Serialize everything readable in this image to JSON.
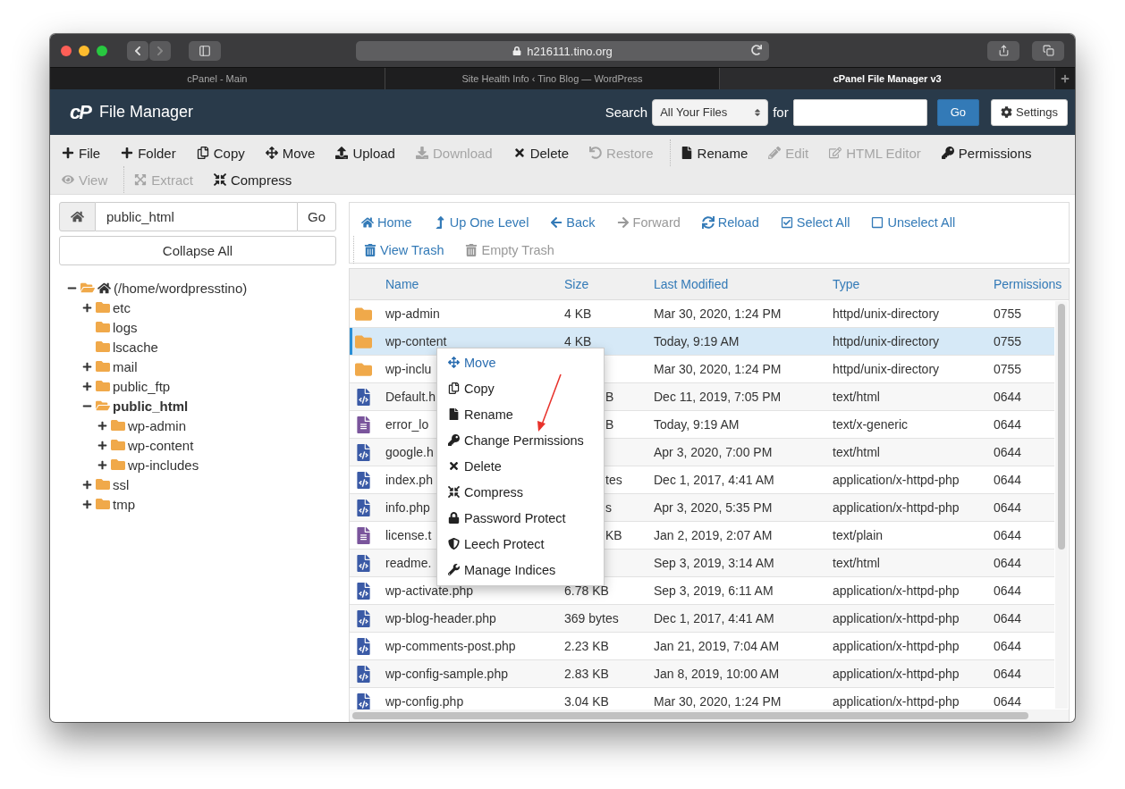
{
  "browser": {
    "url": "h216111.tino.org",
    "tabs": [
      {
        "label": "cPanel - Main",
        "selected": false
      },
      {
        "label": "Site Health Info ‹ Tino Blog — WordPress",
        "selected": false
      },
      {
        "label": "cPanel File Manager v3",
        "selected": true
      }
    ]
  },
  "header": {
    "logo": "cP",
    "title": "File Manager",
    "search_label": "Search",
    "scope": "All Your Files",
    "for_label": "for",
    "go": "Go",
    "settings": "Settings"
  },
  "toolbar": [
    [
      {
        "buttons": [
          {
            "label": "File",
            "disabled": false
          },
          {
            "label": "Folder",
            "disabled": false
          },
          {
            "label": "Copy",
            "disabled": false
          },
          {
            "label": "Move",
            "disabled": false
          },
          {
            "label": "Upload",
            "disabled": false
          },
          {
            "label": "Download",
            "disabled": true
          },
          {
            "label": "Delete",
            "disabled": false
          },
          {
            "label": "Restore",
            "disabled": true
          }
        ]
      },
      {
        "buttons": [
          {
            "label": "Rename",
            "disabled": false
          },
          {
            "label": "Edit",
            "disabled": true
          },
          {
            "label": "HTML Editor",
            "disabled": true
          },
          {
            "label": "Permissions",
            "disabled": false
          }
        ]
      }
    ],
    [
      {
        "buttons": [
          {
            "label": "View",
            "disabled": true
          }
        ]
      },
      {
        "buttons": [
          {
            "label": "Extract",
            "disabled": true
          },
          {
            "label": "Compress",
            "disabled": false
          }
        ]
      }
    ]
  ],
  "path_bar": {
    "value": "public_html",
    "go": "Go"
  },
  "collapse_all": "Collapse All",
  "tree": [
    {
      "label": "(/home/wordpresstino)",
      "root": true,
      "expanded": true,
      "selected": false,
      "children": [
        {
          "label": "etc",
          "expanded": false,
          "selected": false
        },
        {
          "label": "logs",
          "selected": false
        },
        {
          "label": "lscache",
          "selected": false
        },
        {
          "label": "mail",
          "expanded": false,
          "selected": false
        },
        {
          "label": "public_ftp",
          "expanded": false,
          "selected": false
        },
        {
          "label": "public_html",
          "expanded": true,
          "selected": true,
          "children": [
            {
              "label": "wp-admin",
              "expanded": false,
              "selected": false
            },
            {
              "label": "wp-content",
              "expanded": false,
              "selected": false
            },
            {
              "label": "wp-includes",
              "expanded": false,
              "selected": false
            }
          ]
        },
        {
          "label": "ssl",
          "expanded": false,
          "selected": false
        },
        {
          "label": "tmp",
          "expanded": false,
          "selected": false
        }
      ]
    }
  ],
  "nav": [
    {
      "buttons": [
        {
          "label": "Home",
          "disabled": false
        },
        {
          "label": "Up One Level",
          "disabled": false
        },
        {
          "label": "Back",
          "disabled": false
        },
        {
          "label": "Forward",
          "disabled": true
        },
        {
          "label": "Reload",
          "disabled": false
        },
        {
          "label": "Select All",
          "disabled": false
        },
        {
          "label": "Unselect All",
          "disabled": false
        }
      ]
    },
    {
      "buttons": [
        {
          "label": "View Trash",
          "disabled": false
        },
        {
          "label": "Empty Trash",
          "disabled": true
        }
      ]
    }
  ],
  "table": {
    "columns": [
      "Name",
      "Size",
      "Last Modified",
      "Type",
      "Permissions"
    ],
    "rows": [
      {
        "kind": "folder",
        "name": "wp-admin",
        "size": "4 KB",
        "modified": "Mar 30, 2020, 1:24 PM",
        "type": "httpd/unix-directory",
        "perms": "0755",
        "selected": false
      },
      {
        "kind": "folder",
        "name": "wp-content",
        "size": "4 KB",
        "modified": "Today, 9:19 AM",
        "type": "httpd/unix-directory",
        "perms": "0755",
        "selected": true
      },
      {
        "kind": "folder",
        "name": "wp-inclu",
        "modified": "Mar 30, 2020, 1:24 PM",
        "type": "httpd/unix-directory",
        "perms": "0755",
        "selected": false
      },
      {
        "kind": "code",
        "name": "Default.h",
        "size": "B",
        "modified": "Dec 11, 2019, 7:05 PM",
        "type": "text/html",
        "perms": "0644",
        "selected": false,
        "covered": true
      },
      {
        "kind": "text",
        "name": "error_lo",
        "size": "B",
        "modified": "Today, 9:19 AM",
        "type": "text/x-generic",
        "perms": "0644",
        "selected": false,
        "covered": true
      },
      {
        "kind": "code",
        "name": "google.h",
        "modified": "Apr 3, 2020, 7:00 PM",
        "type": "text/html",
        "perms": "0644",
        "selected": false
      },
      {
        "kind": "code",
        "name": "index.ph",
        "size": "tes",
        "modified": "Dec 1, 2017, 4:41 AM",
        "type": "application/x-httpd-php",
        "perms": "0644",
        "selected": false,
        "covered": true
      },
      {
        "kind": "code",
        "name": "info.php",
        "size": "s",
        "modified": "Apr 3, 2020, 5:35 PM",
        "type": "application/x-httpd-php",
        "perms": "0644",
        "selected": false,
        "covered": true
      },
      {
        "kind": "text",
        "name": "license.t",
        "size": "KB",
        "modified": "Jan 2, 2019, 2:07 AM",
        "type": "text/plain",
        "perms": "0644",
        "selected": false,
        "covered": true
      },
      {
        "kind": "code",
        "name": "readme.",
        "modified": "Sep 3, 2019, 3:14 AM",
        "type": "text/html",
        "perms": "0644",
        "selected": false
      },
      {
        "kind": "code",
        "name": "wp-activate.php",
        "size": "6.78 KB",
        "modified": "Sep 3, 2019, 6:11 AM",
        "type": "application/x-httpd-php",
        "perms": "0644",
        "selected": false
      },
      {
        "kind": "code",
        "name": "wp-blog-header.php",
        "size": "369 bytes",
        "modified": "Dec 1, 2017, 4:41 AM",
        "type": "application/x-httpd-php",
        "perms": "0644",
        "selected": false
      },
      {
        "kind": "code",
        "name": "wp-comments-post.php",
        "size": "2.23 KB",
        "modified": "Jan 21, 2019, 7:04 AM",
        "type": "application/x-httpd-php",
        "perms": "0644",
        "selected": false
      },
      {
        "kind": "code",
        "name": "wp-config-sample.php",
        "size": "2.83 KB",
        "modified": "Jan 8, 2019, 10:00 AM",
        "type": "application/x-httpd-php",
        "perms": "0644",
        "selected": false
      },
      {
        "kind": "code",
        "name": "wp-config.php",
        "size": "3.04 KB",
        "modified": "Mar 30, 2020, 1:24 PM",
        "type": "application/x-httpd-php",
        "perms": "0644",
        "selected": false
      }
    ]
  },
  "context_menu": [
    {
      "label": "Move",
      "selected": true
    },
    {
      "label": "Copy",
      "selected": false
    },
    {
      "label": "Rename",
      "selected": false
    },
    {
      "label": "Change Permissions",
      "selected": false
    },
    {
      "label": "Delete",
      "selected": false
    },
    {
      "label": "Compress",
      "selected": false
    },
    {
      "label": "Password Protect",
      "selected": false
    },
    {
      "label": "Leech Protect",
      "selected": false
    },
    {
      "label": "Manage Indices",
      "selected": false
    }
  ]
}
